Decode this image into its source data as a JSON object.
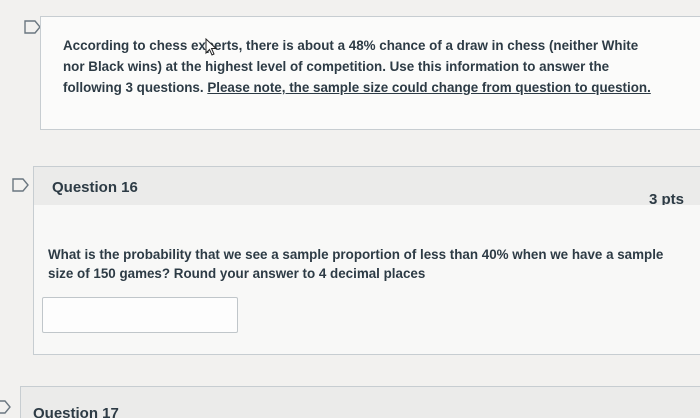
{
  "info": {
    "text_main": "According to chess experts, there is about a 48% chance of a draw in chess (neither White nor Black wins) at the highest level of competition. Use this information to answer the following 3 questions. ",
    "text_note": "Please note, the sample size could change from question to question."
  },
  "question16": {
    "title": "Question 16",
    "points": "3 pts",
    "prompt": "What is the probability that we see a sample proportion of less than 40% when we have a sample size of 150 games? Round your answer to 4 decimal places",
    "answer_value": ""
  },
  "question17": {
    "title": "Question 17"
  },
  "icons": {
    "flag": "bookmark-flag-icon",
    "cursor": "mouse-pointer-icon"
  }
}
